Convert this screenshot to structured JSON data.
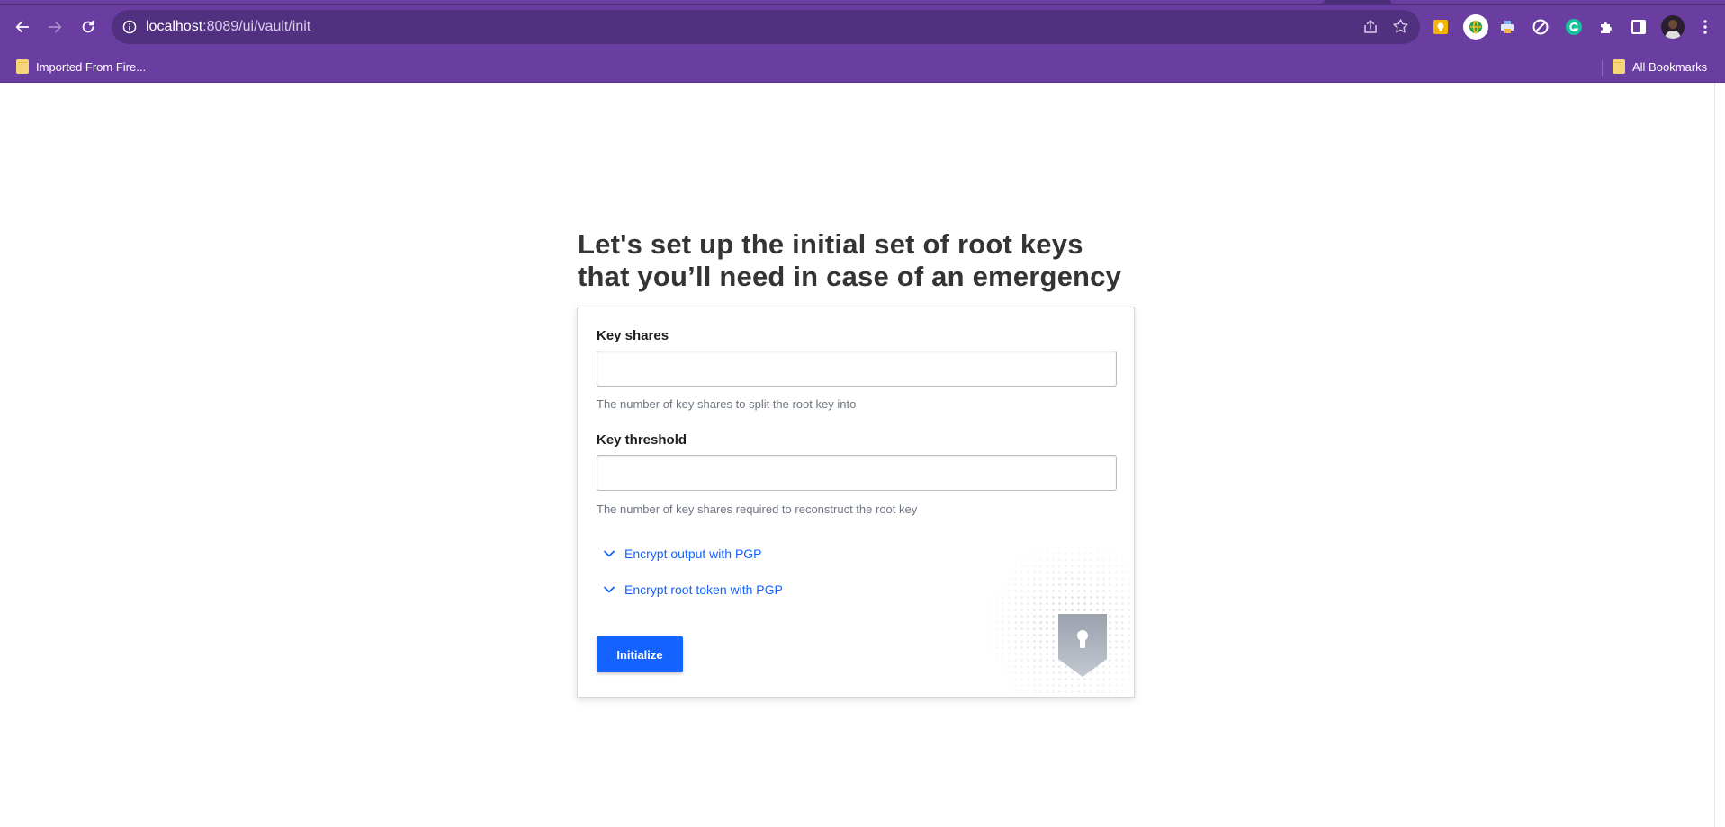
{
  "browser": {
    "url_host": "localhost",
    "url_rest": ":8089/ui/vault/init",
    "bookmarks": {
      "left": "Imported From Fire...",
      "right": "All Bookmarks"
    },
    "extensions": [
      "keep-icon",
      "extension-globe-icon",
      "printer-icon",
      "block-icon",
      "grammarly-icon",
      "puzzle-icon",
      "sidepanel-icon",
      "profile-avatar",
      "kebab-menu-icon"
    ]
  },
  "page": {
    "heading": "Let's set up the initial set of root keys that you’ll need in case of an emergency",
    "key_shares": {
      "label": "Key shares",
      "value": "",
      "help": "The number of key shares to split the root key into"
    },
    "key_threshold": {
      "label": "Key threshold",
      "value": "",
      "help": "The number of key shares required to reconstruct the root key"
    },
    "toggles": [
      {
        "label": "Encrypt output with PGP"
      },
      {
        "label": "Encrypt root token with PGP"
      }
    ],
    "submit_label": "Initialize"
  },
  "colors": {
    "browser_purple": "#6a3ea1",
    "link_blue": "#1563ff",
    "button_blue": "#1563ff"
  }
}
